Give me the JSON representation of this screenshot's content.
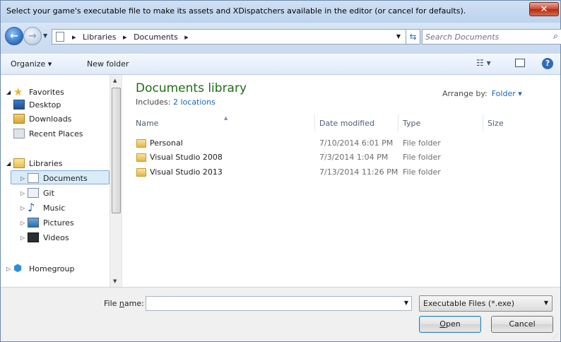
{
  "window": {
    "title": "Select your game's executable file to make its assets and XDispatchers available in the editor (or cancel for defaults).",
    "close_glyph": "✕"
  },
  "address": {
    "breadcrumb": [
      "Libraries",
      "Documents"
    ],
    "search_placeholder": "Search Documents"
  },
  "toolbar": {
    "organize_label": "Organize ▾",
    "new_folder_label": "New folder",
    "views_glyph": "☷ ▾",
    "help_glyph": "?"
  },
  "nav": {
    "favorites": {
      "label": "Favorites",
      "items": [
        "Desktop",
        "Downloads",
        "Recent Places"
      ]
    },
    "libraries": {
      "label": "Libraries",
      "items": [
        "Documents",
        "Git",
        "Music",
        "Pictures",
        "Videos"
      ]
    },
    "homegroup": "Homegroup",
    "selected": "Documents"
  },
  "content": {
    "title": "Documents library",
    "includes_prefix": "Includes: ",
    "includes_link": "2 locations",
    "arrange_label": "Arrange by:",
    "arrange_value": "Folder ▾",
    "columns": {
      "name": "Name",
      "date": "Date modified",
      "type": "Type",
      "size": "Size"
    },
    "files": [
      {
        "name": "Personal",
        "date": "7/10/2014 6:01 PM",
        "type": "File folder"
      },
      {
        "name": "Visual Studio 2008",
        "date": "7/3/2014 1:04 PM",
        "type": "File folder"
      },
      {
        "name": "Visual Studio 2013",
        "date": "7/13/2014 11:26 PM",
        "type": "File folder"
      }
    ]
  },
  "bottom": {
    "file_name_label_pre": "File ",
    "file_name_label_u": "n",
    "file_name_label_post": "ame:",
    "file_name_value": "",
    "filter_value": "Executable Files (*.exe)",
    "open_u": "O",
    "open_rest": "pen",
    "cancel_label": "Cancel"
  }
}
